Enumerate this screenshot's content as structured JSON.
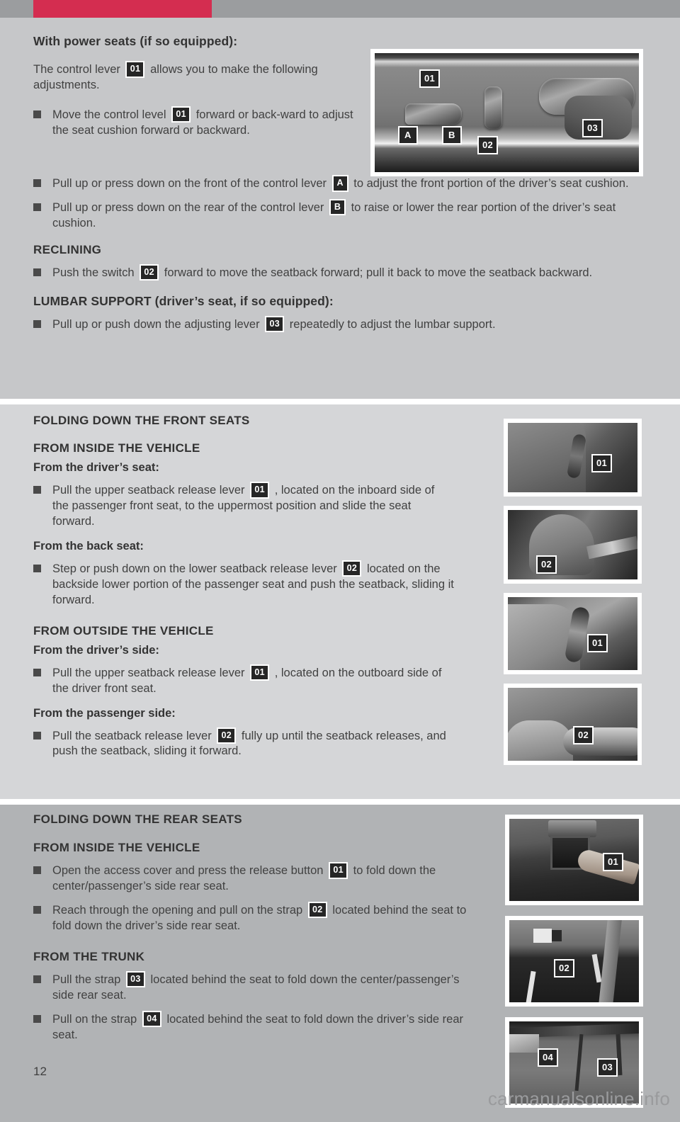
{
  "document": {
    "page_number": "12",
    "watermark": "carmanualsonline.info",
    "accent_color": "#d42d50",
    "topbar_color": "#9b9d9f"
  },
  "section1": {
    "heading": "With power seats (if so equipped):",
    "intro_before": "The control lever",
    "intro_chip": "01",
    "intro_after": "allows you to make the following adjustments.",
    "bullets": [
      {
        "before": "Move the control level",
        "chip": "01",
        "after": "forward or back-ward to adjust the seat cushion forward or backward."
      },
      {
        "before": "Pull up or press down on the front of the control lever",
        "chip": "A",
        "after": "to adjust the front portion of the driver’s seat cushion."
      },
      {
        "before": "Pull up or press down on the rear of the control lever",
        "chip": "B",
        "after": "to raise or lower the rear portion of the driver’s seat cushion."
      }
    ],
    "reclining_heading": "RECLINING",
    "reclining_bullet": {
      "before": "Push the switch",
      "chip": "02",
      "after": "forward to move the seatback forward; pull it back to move the seatback backward."
    },
    "lumbar_heading": "LUMBAR SUPPORT (driver’s seat, if so equipped):",
    "lumbar_bullet": {
      "before": "Pull up or push down the adjusting lever",
      "chip": "03",
      "after": "repeatedly to adjust the lumbar support."
    },
    "photo": {
      "name": "power-seat-control-photo",
      "tags": [
        "01",
        "A",
        "B",
        "02",
        "03"
      ]
    }
  },
  "section2": {
    "heading": "FOLDING DOWN THE FRONT SEATS",
    "sub1": "FROM INSIDE THE VEHICLE",
    "sub1a": "From the driver’s seat:",
    "bullet1": {
      "before": "Pull the upper seatback release lever",
      "chip": "01",
      "after": ", located on the inboard side of the passenger front seat, to the uppermost position and slide the seat forward."
    },
    "sub1b": "From the back seat:",
    "bullet2": {
      "before": "Step or push down on the lower seatback release lever",
      "chip": "02",
      "after": "located on the backside lower portion of the passenger seat and push the seatback, sliding it forward."
    },
    "sub2": "FROM OUTSIDE THE VEHICLE",
    "sub2a": "From the driver’s side:",
    "bullet3": {
      "before": "Pull the upper seatback release lever",
      "chip": "01",
      "after": ", located on the outboard side of the driver front seat."
    },
    "sub2b": "From the passenger side:",
    "bullet4": {
      "before": "Pull the seatback release lever",
      "chip": "02",
      "after": "fully up until the seatback releases, and push the seatback, sliding it forward."
    },
    "photos": [
      {
        "name": "upper-seatback-release-lever-inboard-photo",
        "tag": "01"
      },
      {
        "name": "lower-seatback-release-lever-photo",
        "tag": "02"
      },
      {
        "name": "upper-seatback-release-lever-outboard-photo",
        "tag": "01"
      },
      {
        "name": "passenger-side-seatback-release-lever-photo",
        "tag": "02"
      }
    ]
  },
  "section3": {
    "heading": "FOLDING DOWN THE REAR SEATS",
    "sub1": "FROM INSIDE THE VEHICLE",
    "bullet1": {
      "before": "Open the access cover and press the release button",
      "chip": "01",
      "after": "to fold down the center/passenger’s side rear seat."
    },
    "bullet2": {
      "before": "Reach through the opening and pull on the strap",
      "chip": "02",
      "after": "located behind the seat to fold down the driver’s side rear seat."
    },
    "sub2": "FROM THE TRUNK",
    "bullet3": {
      "before": "Pull the strap",
      "chip": "03",
      "after": "located behind the seat to fold down the center/passenger’s side rear seat."
    },
    "bullet4": {
      "before": "Pull on the strap",
      "chip": "04",
      "after": "located behind the seat to fold down the driver’s side rear seat."
    },
    "photos": [
      {
        "name": "rear-seat-release-button-photo",
        "tag": "01"
      },
      {
        "name": "rear-seat-strap-opening-photo",
        "tag": "02"
      },
      {
        "name": "trunk-straps-photo",
        "tags": [
          "04",
          "03"
        ]
      }
    ]
  }
}
